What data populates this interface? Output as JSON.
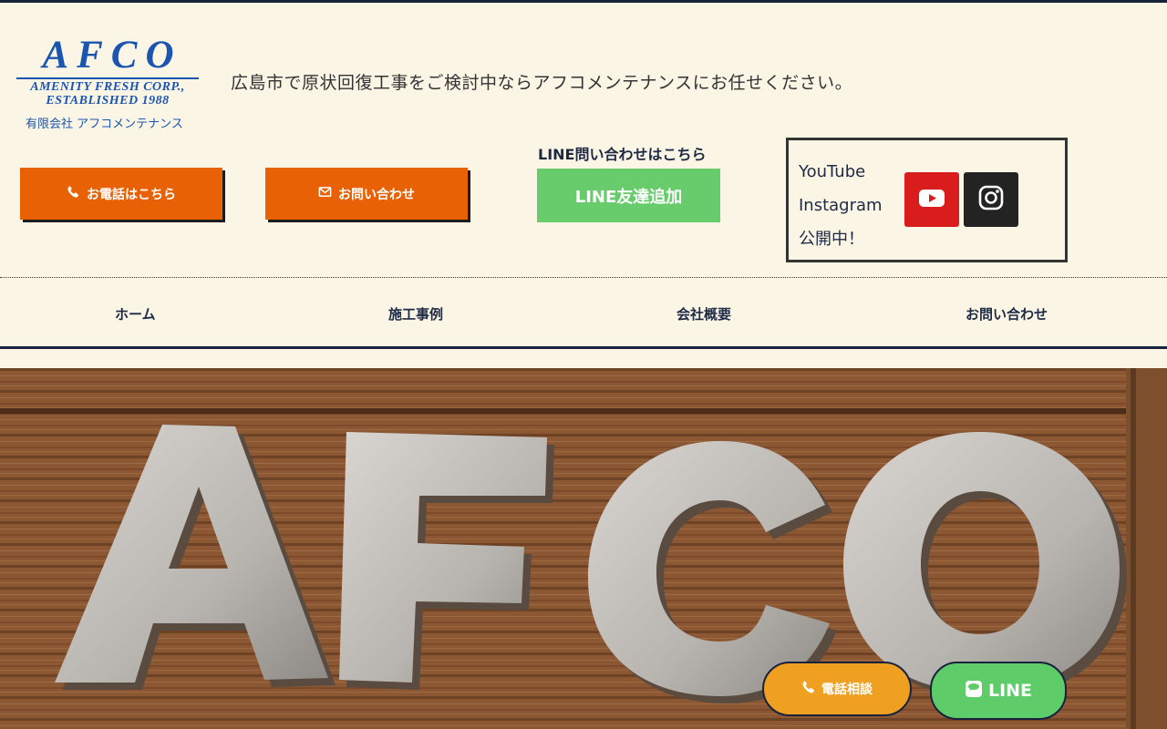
{
  "header": {
    "logo": {
      "title": "AFCO",
      "line1": "AMENITY FRESH CORP.,",
      "line2": "ESTABLISHED 1988",
      "company": "有限会社 アフコメンテナンス"
    },
    "tagline": "広島市で原状回復工事をご検討中ならアフコメンテナンスにお任せください。",
    "phone_button": "お電話はこちら",
    "contact_button": "お問い合わせ",
    "line_caption": "LINE問い合わせはこちら",
    "line_add_button": "LINE友達追加",
    "social": {
      "youtube": "YouTube",
      "instagram": "Instagram",
      "public": "公開中！"
    }
  },
  "nav": {
    "items": [
      "ホーム",
      "施工事例",
      "会社概要",
      "お問い合わせ"
    ]
  },
  "floating": {
    "phone": "電話相談",
    "line": "LINE"
  },
  "colors": {
    "background": "#fbf5e6",
    "navy": "#17233d",
    "orange": "#e86205",
    "line_green": "#68cc6d",
    "youtube_red": "#d91c1c",
    "phone_float": "#f0a021"
  },
  "icons": [
    "phone-icon",
    "mail-icon",
    "youtube-icon",
    "instagram-icon",
    "line-icon"
  ]
}
